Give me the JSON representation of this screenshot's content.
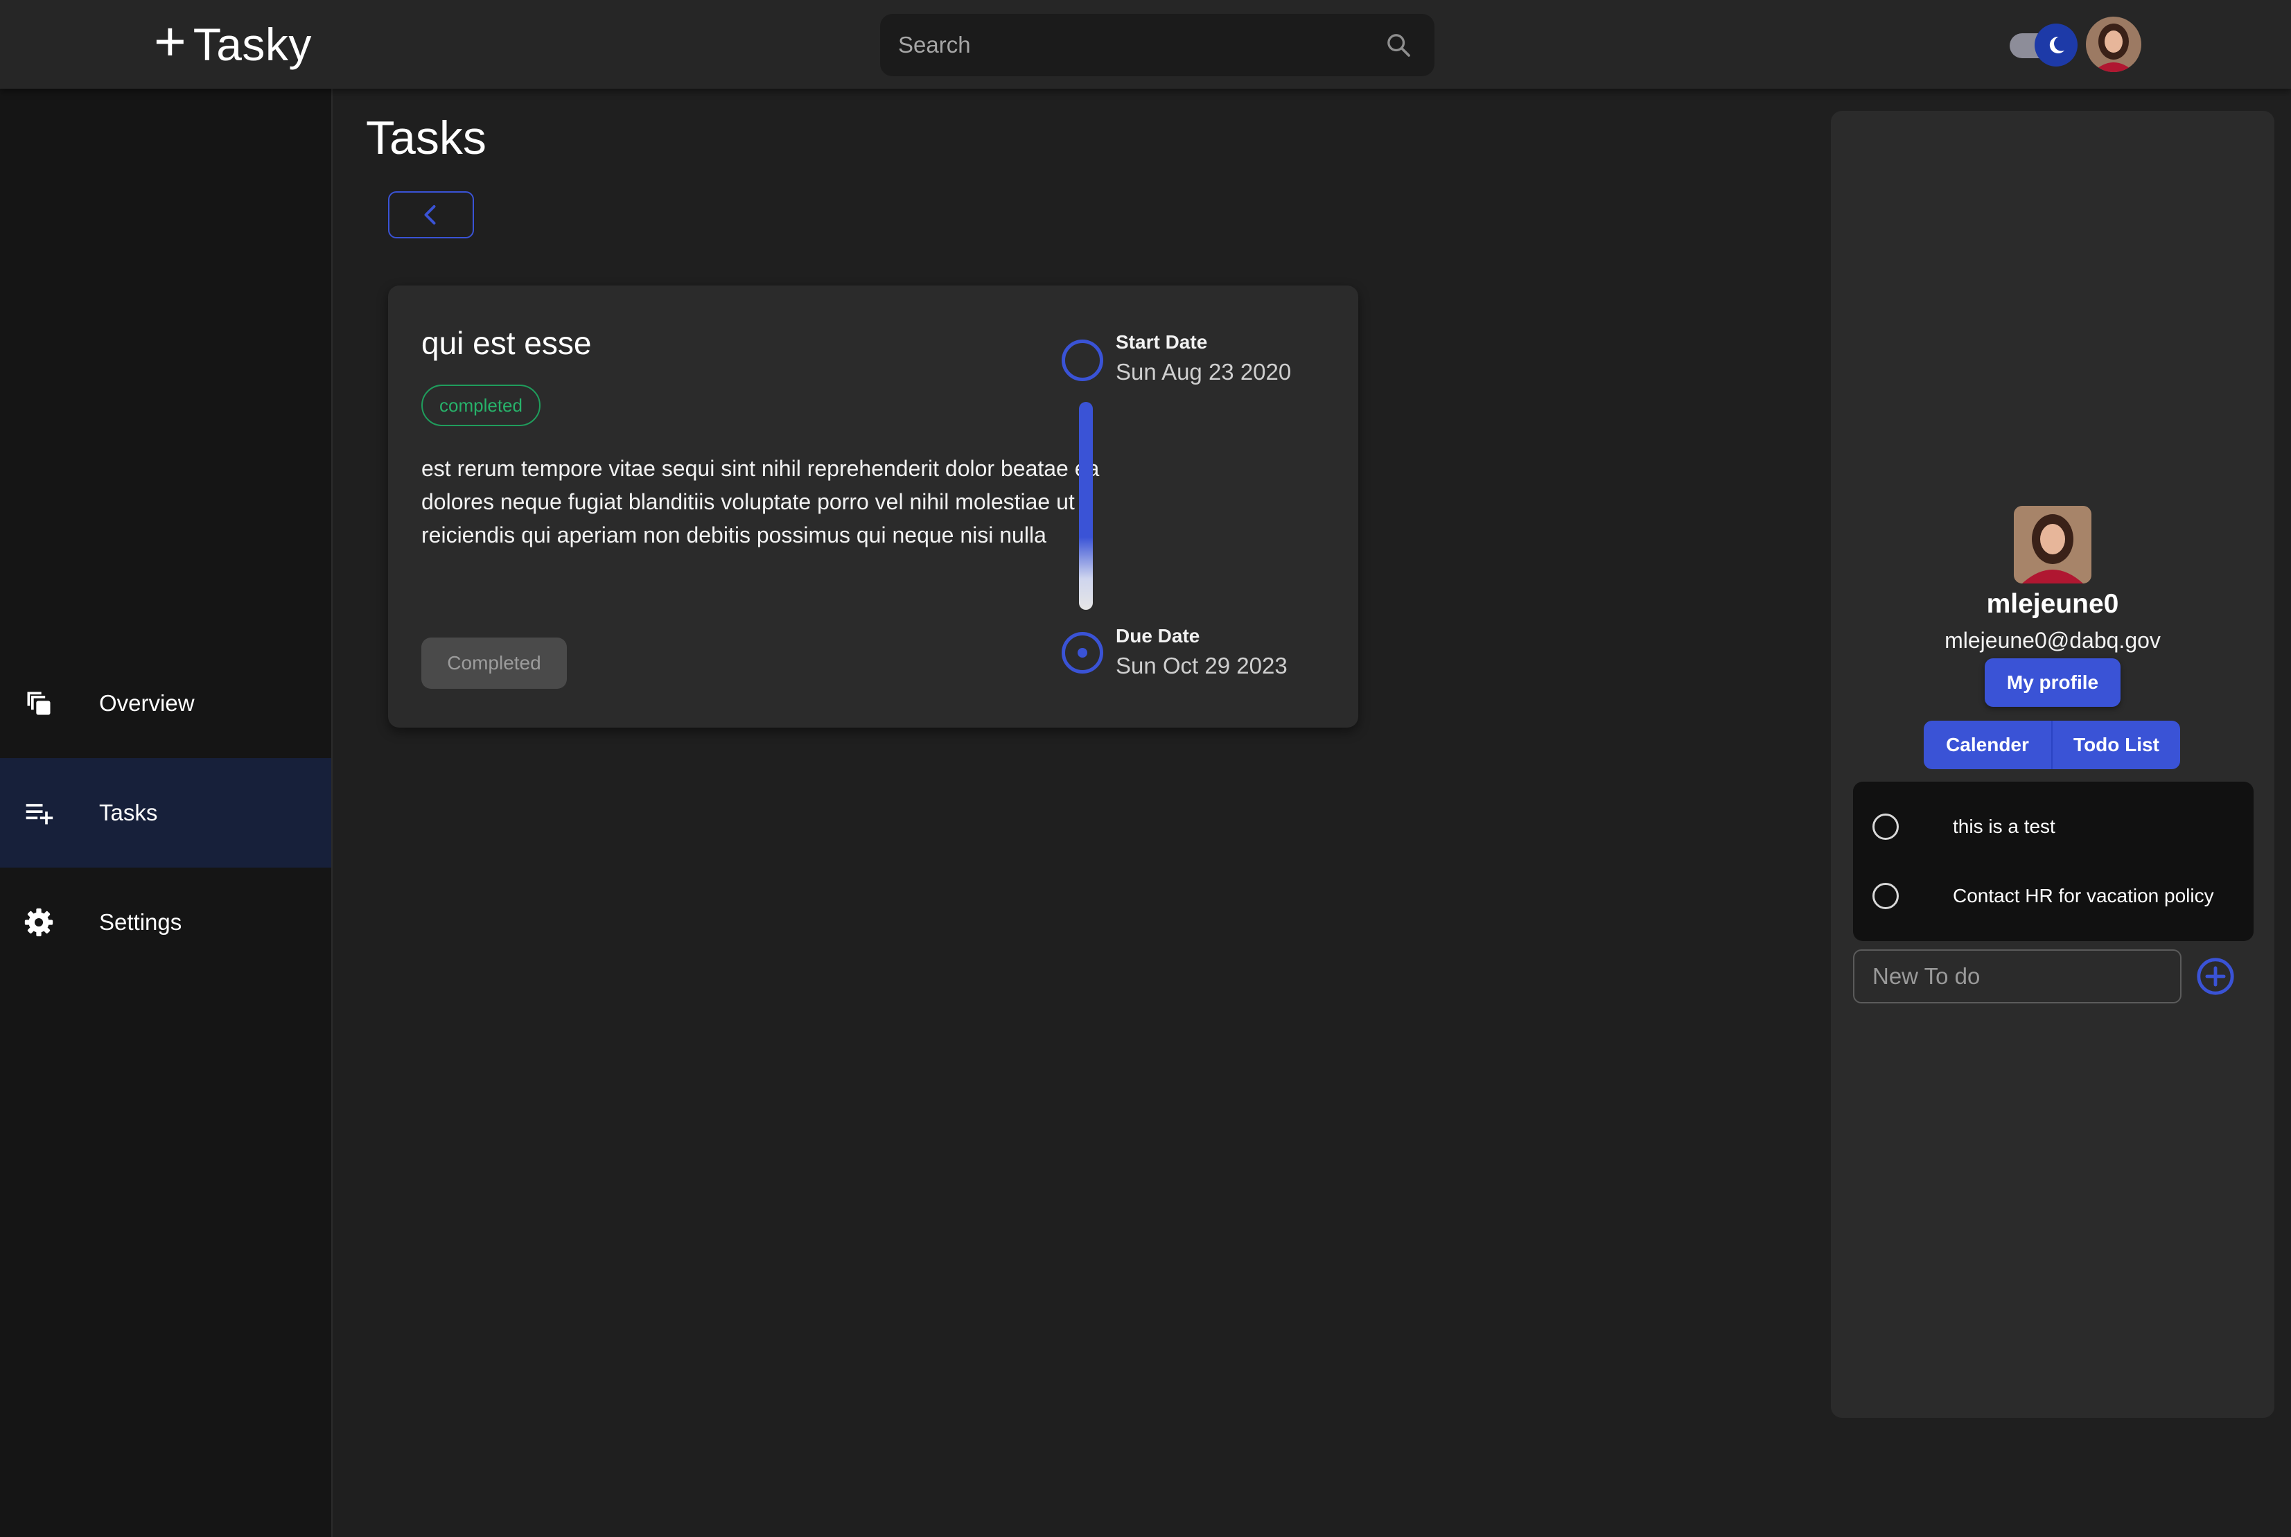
{
  "brand": {
    "plus": "+",
    "name": "Tasky"
  },
  "search": {
    "placeholder": "Search",
    "icon": "search-icon"
  },
  "theme": {
    "icon": "moon-icon",
    "accent": "#3a53d6"
  },
  "sidebar": {
    "items": [
      {
        "label": "Overview",
        "icon": "overview-icon",
        "active": false
      },
      {
        "label": "Tasks",
        "icon": "playlist-add-icon",
        "active": true
      },
      {
        "label": "Settings",
        "icon": "gear-icon",
        "active": false
      }
    ]
  },
  "main": {
    "title": "Tasks",
    "back_icon": "chevron-left-icon",
    "task": {
      "title": "qui est esse",
      "status": "completed",
      "description": "est rerum tempore vitae sequi sint nihil reprehenderit dolor beatae ea dolores neque fugiat blanditiis voluptate porro vel nihil molestiae ut reiciendis qui aperiam non debitis possimus qui neque nisi nulla",
      "action_label": "Completed",
      "start_label": "Start Date",
      "start_date": "Sun Aug 23 2020",
      "due_label": "Due Date",
      "due_date": "Sun Oct 29 2023",
      "status_color": "#27b26a"
    }
  },
  "panel": {
    "username": "mlejeune0",
    "email": "mlejeune0@dabq.gov",
    "profile_button": "My profile",
    "tabs": [
      "Calender",
      "Todo List"
    ],
    "todos": [
      {
        "text": "this is a test",
        "done": false
      },
      {
        "text": "Contact HR for vacation policy",
        "done": false
      }
    ],
    "new_todo_placeholder": "New To do",
    "add_icon": "plus-circle-icon"
  }
}
